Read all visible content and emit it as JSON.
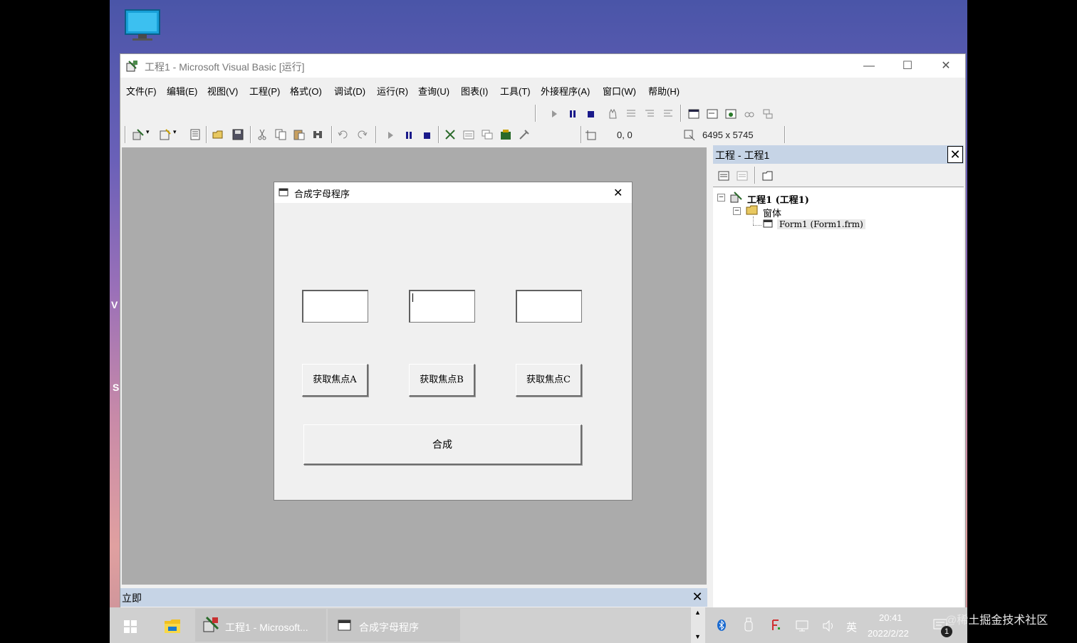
{
  "desktop": {
    "letters": [
      "V",
      "S"
    ]
  },
  "window": {
    "title": "工程1 - Microsoft Visual Basic [运行]",
    "controls": {
      "minimize": "—",
      "maximize": "☐",
      "close": "✕"
    }
  },
  "menu": [
    "文件(F)",
    "编辑(E)",
    "视图(V)",
    "工程(P)",
    "格式(O)",
    "调试(D)",
    "运行(R)",
    "查询(U)",
    "图表(I)",
    "工具(T)",
    "外接程序(A)",
    "窗口(W)",
    "帮助(H)"
  ],
  "toolbar": {
    "position": "0, 0",
    "size": "6495 x 5745"
  },
  "form": {
    "title": "合成字母程序",
    "close": "✕",
    "textboxes": [
      "",
      "",
      ""
    ],
    "buttons": {
      "a": "获取焦点A",
      "b": "获取焦点B",
      "c": "获取焦点C",
      "combine": "合成"
    }
  },
  "project_panel": {
    "title": "工程 - 工程1",
    "close": "✕",
    "tree": {
      "root": "工程1 (工程1)",
      "folder": "窗体",
      "item": "Form1 (Form1.frm)"
    }
  },
  "immediate": {
    "title": "立即",
    "close": "✕"
  },
  "taskbar": {
    "items": [
      {
        "label": "工程1 - Microsoft..."
      },
      {
        "label": "合成字母程序"
      }
    ],
    "ime": "英",
    "time": "20:41",
    "date": "2022/2/22",
    "notification_count": "1"
  },
  "watermark": "@稀土掘金技术社区",
  "colors": {
    "panel_title": "#c6d4e6",
    "mdi_bg": "#ababab",
    "taskbar": "#d0d0d0"
  }
}
